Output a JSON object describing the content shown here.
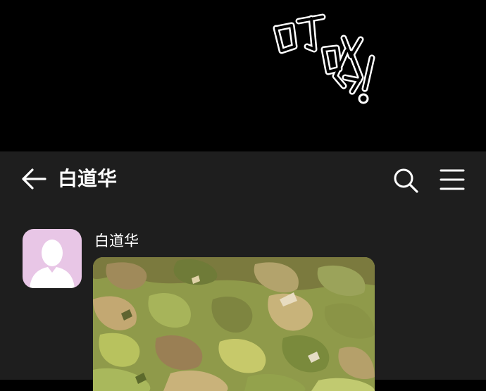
{
  "sfx": {
    "text": "叮咚!"
  },
  "header": {
    "title": "白道华"
  },
  "message": {
    "sender": "白道华",
    "type": "image"
  },
  "icons": {
    "back": "arrow-left-icon",
    "search": "search-icon",
    "menu": "menu-icon",
    "avatar": "person-silhouette-icon"
  },
  "colors": {
    "chat_bg": "#1e1e1e",
    "avatar_bg": "#e8c6e6",
    "text": "#ffffff"
  }
}
